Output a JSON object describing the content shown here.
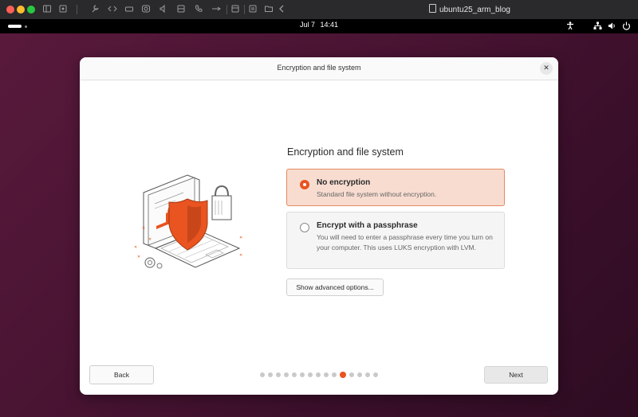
{
  "host": {
    "window_title": "ubuntu25_arm_blog",
    "toolbar_icons": [
      "sidebar-icon",
      "settings-icon",
      "wrench-icon",
      "code-icon",
      "drive-icon",
      "camera-icon",
      "speaker-icon",
      "storage-icon",
      "phone-icon",
      "usb-icon",
      "printer-icon",
      "share-icon",
      "folder-icon",
      "back-icon"
    ]
  },
  "topbar": {
    "date": "Jul 7",
    "time": "14:41",
    "icons": [
      "accessibility-icon",
      "network-icon",
      "volume-icon",
      "power-icon"
    ]
  },
  "dialog": {
    "title": "Encryption and file system",
    "close_icon": "close-icon",
    "heading": "Encryption and file system",
    "options": [
      {
        "title": "No encryption",
        "desc": "Standard file system without encryption.",
        "selected": true
      },
      {
        "title": "Encrypt with a passphrase",
        "desc": "You will need to enter a passphrase every time you turn on your computer. This uses LUKS encryption with LVM.",
        "selected": false
      }
    ],
    "advanced_label": "Show advanced options...",
    "back_label": "Back",
    "next_label": "Next",
    "progress": {
      "total": 15,
      "current": 10
    },
    "accent_color": "#e95420"
  }
}
